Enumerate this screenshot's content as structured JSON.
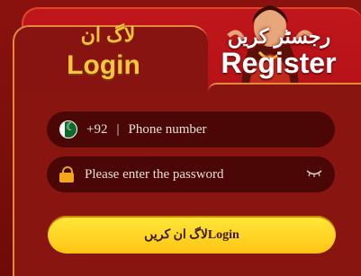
{
  "tabs": {
    "login": {
      "urdu": "لاگ ان",
      "label": "Login",
      "active": true
    },
    "register": {
      "urdu": "رجسٹر کریں",
      "label": "Register",
      "active": false
    }
  },
  "form": {
    "phone": {
      "flag_icon": "pakistan-flag-icon",
      "country_code": "+92",
      "separator": "|",
      "placeholder": "Phone number"
    },
    "password": {
      "lock_icon": "lock-icon",
      "placeholder": "Please enter the password",
      "toggle_icon": "eye-closed-icon"
    },
    "submit_label": "لاگ ان کریںLogin"
  },
  "colors": {
    "background": "#7a0d0a",
    "panel": "#881510",
    "field": "#4a0705",
    "accent_gold": "#f7c63c",
    "register_tab": "#c0161b",
    "button": "#ffd31f"
  }
}
